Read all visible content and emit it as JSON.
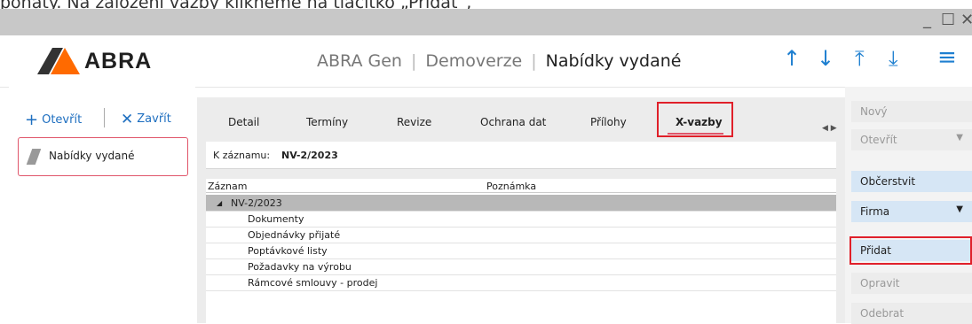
{
  "caption": "pohaty. Na založení vazby klikneme na tlačítko „Přidat“,",
  "window": {
    "minimize": "_",
    "maximize": "☐",
    "close": "✕"
  },
  "header": {
    "logo": "ABRA",
    "app": "ABRA Gen",
    "mode": "Demoverze",
    "title": "Nabídky vydané",
    "icons": [
      "arrow-up-icon",
      "arrow-down-icon",
      "arrow-top-icon",
      "arrow-bottom-icon",
      "menu-icon"
    ]
  },
  "left": {
    "open": "Otevřít",
    "close": "Zavřít",
    "nav_item": "Nabídky vydané"
  },
  "tabs": [
    "Detail",
    "Termíny",
    "Revize",
    "Ochrana dat",
    "Přílohy",
    "X-vazby"
  ],
  "record": {
    "label": "K záznamu:",
    "value": "NV-2/2023"
  },
  "grid": {
    "columns": [
      "Záznam",
      "Poznámka"
    ],
    "root": "NV-2/2023",
    "rows": [
      "Dokumenty",
      "Objednávky přijaté",
      "Poptávkové listy",
      "Požadavky na výrobu",
      "Rámcové smlouvy - prodej"
    ]
  },
  "right": {
    "new": "Nový",
    "open": "Otevřít",
    "refresh": "Občerstvit",
    "company": "Firma",
    "add": "Přidat",
    "edit": "Opravit",
    "remove": "Odebrat"
  },
  "colors": {
    "accent": "#1e7fd0",
    "highlight": "#e0202a",
    "logo": "#ff6a00"
  }
}
